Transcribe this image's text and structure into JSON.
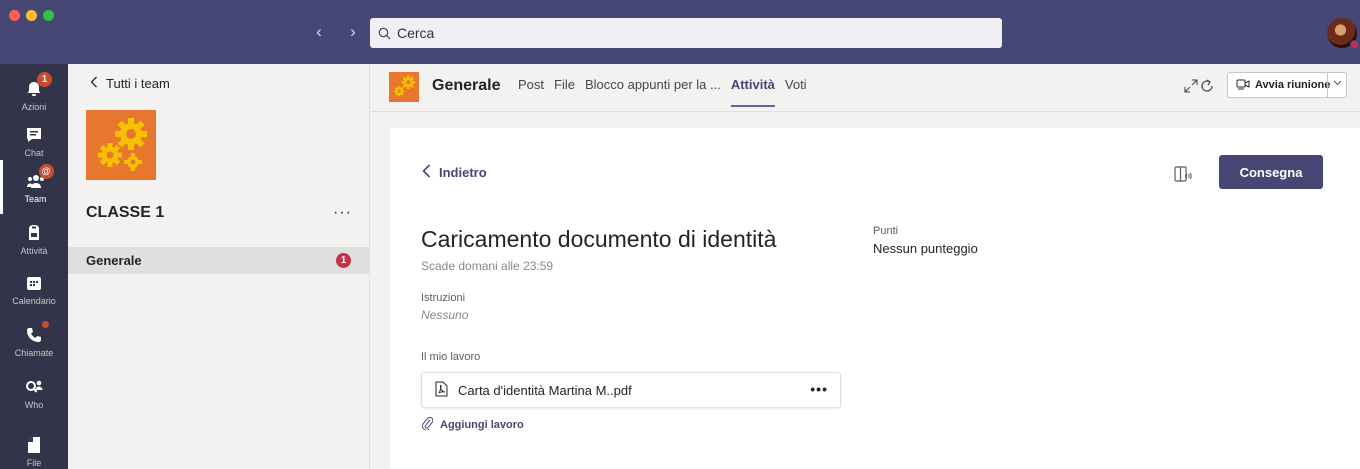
{
  "window": {
    "traffic_colors": [
      "#ff5f57",
      "#febc2e",
      "#28c840"
    ]
  },
  "titlebar": {
    "back_arrow": "‹",
    "forward_arrow": "›",
    "search_placeholder": "Cerca"
  },
  "rail": {
    "items": [
      {
        "label": "Azioni",
        "icon": "bell-icon",
        "badge": "1"
      },
      {
        "label": "Chat",
        "icon": "chat-icon"
      },
      {
        "label": "Team",
        "icon": "team-icon",
        "badge": "@"
      },
      {
        "label": "Attività",
        "icon": "backpack-icon"
      },
      {
        "label": "Calendario",
        "icon": "calendar-icon"
      },
      {
        "label": "Chiamate",
        "icon": "phone-icon"
      },
      {
        "label": "Who",
        "icon": "who-icon"
      },
      {
        "label": "File",
        "icon": "file-icon"
      }
    ]
  },
  "teamlist": {
    "back_label": "Tutti i team",
    "team_name": "CLASSE 1",
    "more": "···",
    "channel": {
      "name": "Generale",
      "badge": "1"
    }
  },
  "channel_header": {
    "name": "Generale",
    "tabs": [
      {
        "label": "Post",
        "active": false
      },
      {
        "label": "File",
        "active": false
      },
      {
        "label": "Blocco appunti per la ...",
        "active": false
      },
      {
        "label": "Attività",
        "active": true
      },
      {
        "label": "Voti",
        "active": false
      }
    ],
    "meet_label": "Avvia riunione"
  },
  "assignment": {
    "back_label": "Indietro",
    "submit_label": "Consegna",
    "title": "Caricamento documento di identità",
    "due": "Scade domani alle 23:59",
    "points_label": "Punti",
    "points_value": "Nessun punteggio",
    "instructions_label": "Istruzioni",
    "instructions_value": "Nessuno",
    "my_work_label": "Il mio lavoro",
    "file_name": "Carta d'identità Martina M..pdf",
    "file_more": "•••",
    "add_work_label": "Aggiungi lavoro"
  },
  "colors": {
    "brand": "#464775",
    "rail_bg": "#33344a",
    "badge": "#cc4a31",
    "team_logo": "#e8772e"
  }
}
